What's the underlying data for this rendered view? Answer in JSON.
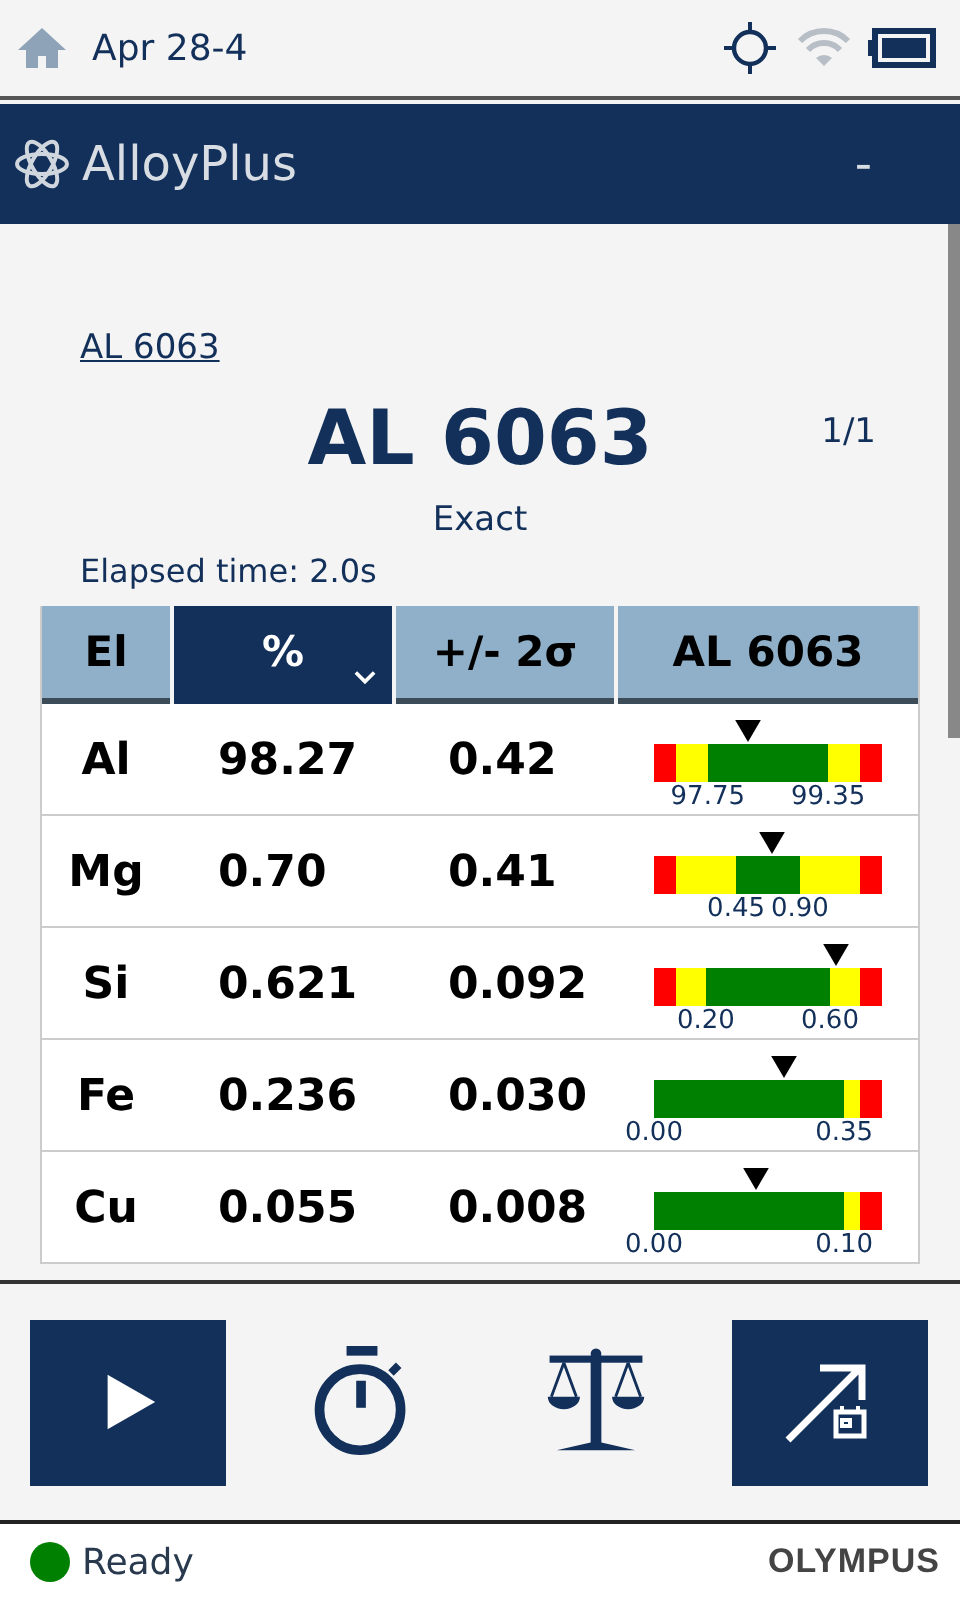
{
  "status_bar": {
    "date": "Apr 28-4"
  },
  "app_bar": {
    "title": "AlloyPlus",
    "menu": "-"
  },
  "result": {
    "link": "AL 6063",
    "grade": "AL 6063",
    "count": "1/1",
    "match": "Exact",
    "elapsed": "Elapsed time: 2.0s"
  },
  "table": {
    "columns": [
      {
        "label": "El",
        "selected": false
      },
      {
        "label": "%",
        "selected": true
      },
      {
        "label": "+/- 2σ",
        "selected": false
      },
      {
        "label": "AL 6063",
        "selected": false
      }
    ],
    "rows": [
      {
        "element": "Al",
        "percent": "98.27",
        "error": "0.42",
        "marker": {
          "shown": true
        },
        "low": "97.75",
        "high": "99.35",
        "segments": [
          {
            "color": "#ff0000"
          },
          {
            "color": "#ffff00"
          },
          {
            "color": "#008000"
          },
          {
            "color": "#ffff00"
          },
          {
            "color": "#ff0000"
          }
        ]
      },
      {
        "element": "Mg",
        "percent": "0.70",
        "error": "0.41",
        "marker": {
          "shown": true
        },
        "low": "0.45",
        "high": "0.90",
        "segments": [
          {
            "color": "#ff0000"
          },
          {
            "color": "#ffff00"
          },
          {
            "color": "#008000"
          },
          {
            "color": "#ffff00"
          },
          {
            "color": "#ff0000"
          }
        ]
      },
      {
        "element": "Si",
        "percent": "0.621",
        "error": "0.092",
        "marker": {
          "shown": true
        },
        "low": "0.20",
        "high": "0.60",
        "segments": [
          {
            "color": "#ff0000"
          },
          {
            "color": "#ffff00"
          },
          {
            "color": "#008000"
          },
          {
            "color": "#ffff00"
          },
          {
            "color": "#ff0000"
          }
        ]
      },
      {
        "element": "Fe",
        "percent": "0.236",
        "error": "0.030",
        "marker": {
          "shown": true
        },
        "low": "0.00",
        "high": "0.35",
        "segments": [
          {
            "color": "#008000"
          },
          {
            "color": "#ffff00"
          },
          {
            "color": "#ff0000"
          }
        ]
      },
      {
        "element": "Cu",
        "percent": "0.055",
        "error": "0.008",
        "marker": {
          "shown": true
        },
        "low": "0.00",
        "high": "0.10",
        "segments": [
          {
            "color": "#008000"
          },
          {
            "color": "#ffff00"
          },
          {
            "color": "#ff0000"
          }
        ]
      }
    ]
  },
  "toolbar": [
    {
      "kind": "play",
      "filled": true
    },
    {
      "kind": "timer",
      "filled": false
    },
    {
      "kind": "scale",
      "filled": false
    },
    {
      "kind": "export",
      "filled": true
    }
  ],
  "footer": {
    "status": "Ready",
    "ready": true,
    "brand": "OLYMPUS"
  }
}
